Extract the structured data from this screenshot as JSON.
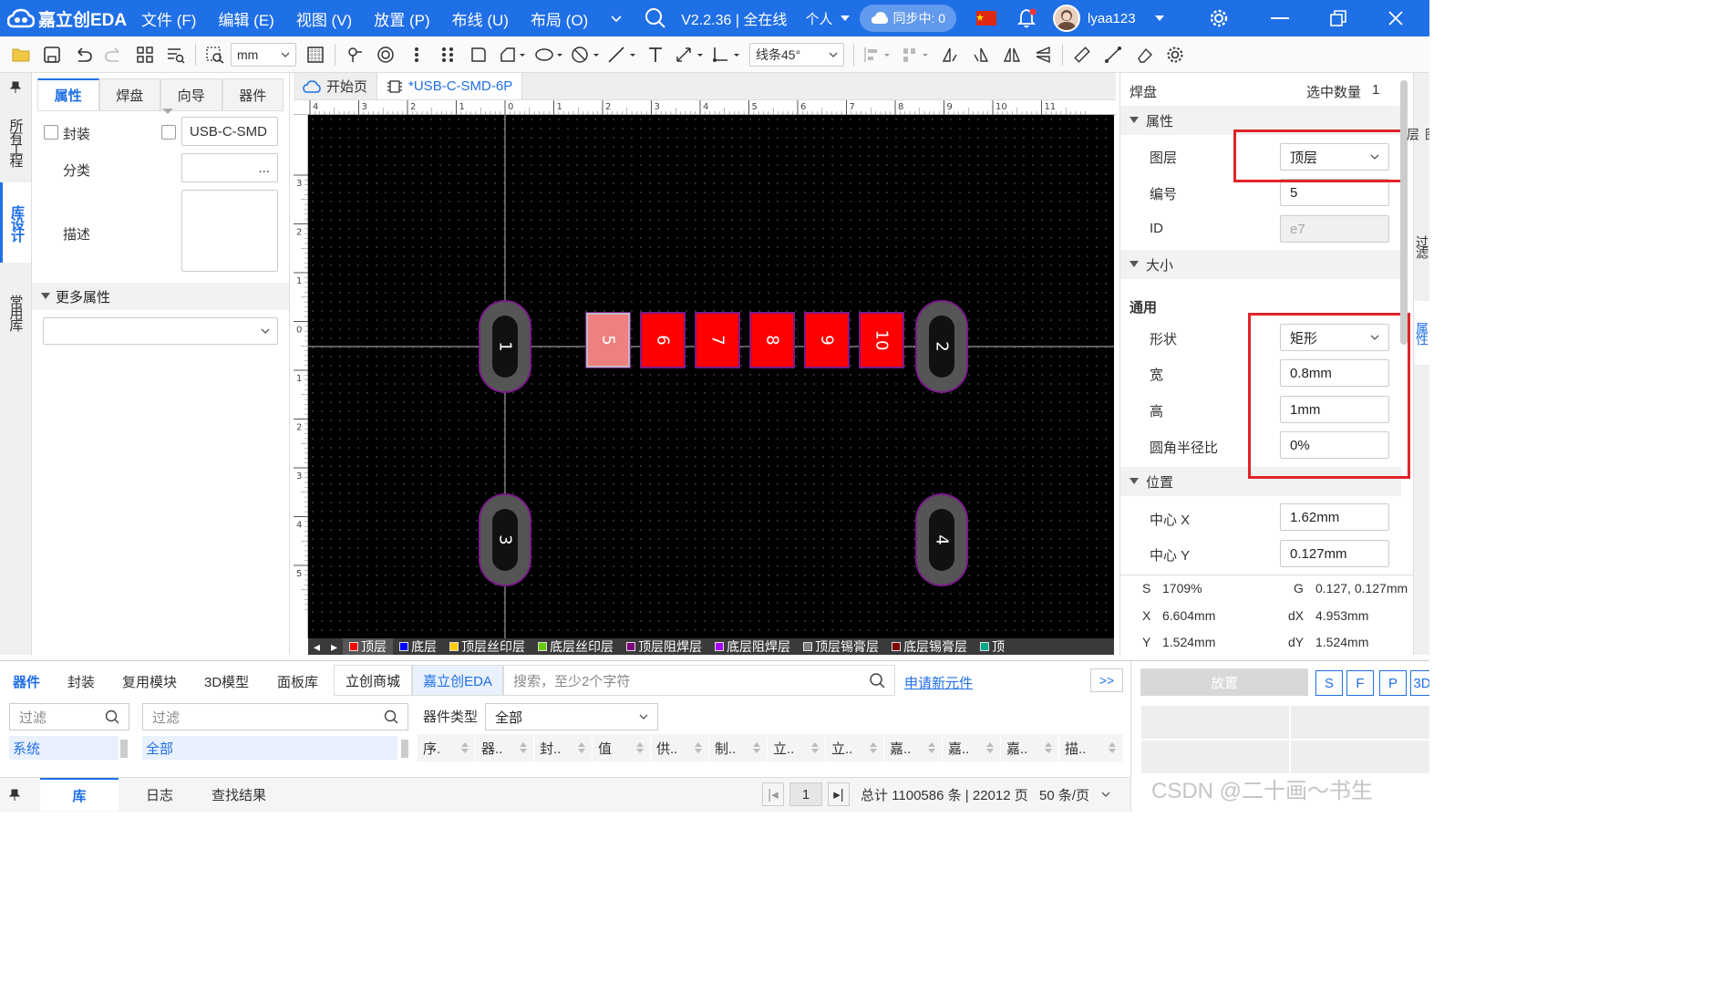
{
  "app": {
    "logo": "嘉立创EDA",
    "menus": [
      "文件 (F)",
      "编辑 (E)",
      "视图 (V)",
      "放置 (P)",
      "布线 (U)",
      "布局 (O)"
    ],
    "version": "V2.2.36 | 全在线",
    "mode": "个人",
    "sync": "同步中: 0",
    "user": "lyaa123"
  },
  "toolbar": {
    "unit": "mm",
    "line_mode": "线条45°"
  },
  "left_tabs": [
    "所有工程",
    "库设计",
    "常用库"
  ],
  "left_panel": {
    "tabs": [
      "属性",
      "焊盘",
      "向导",
      "器件"
    ],
    "footprint_label": "封装",
    "footprint_value": "USB-C-SMD",
    "category_label": "分类",
    "category_btn": "...",
    "desc_label": "描述",
    "more_props": "更多属性"
  },
  "doc_tabs": [
    "开始页",
    "*USB-C-SMD-6P"
  ],
  "ruler_x": [
    "4",
    "3",
    "2",
    "1",
    "0",
    "1",
    "2",
    "3",
    "4",
    "5",
    "6",
    "7",
    "8",
    "9",
    "10",
    "11"
  ],
  "ruler_y": [
    "3",
    "2",
    "1",
    "0",
    "1",
    "2",
    "3",
    "4",
    "5"
  ],
  "pads": [
    {
      "label": "1",
      "kind": "oval",
      "color": "#555555"
    },
    {
      "label": "2",
      "kind": "oval",
      "color": "#555555"
    },
    {
      "label": "3",
      "kind": "oval",
      "color": "#555555"
    },
    {
      "label": "4",
      "kind": "oval",
      "color": "#555555"
    },
    {
      "label": "5",
      "kind": "rect",
      "color": "#f08080",
      "selected": true
    },
    {
      "label": "6",
      "kind": "rect",
      "color": "#ff0000"
    },
    {
      "label": "7",
      "kind": "rect",
      "color": "#ff0000"
    },
    {
      "label": "8",
      "kind": "rect",
      "color": "#ff0000"
    },
    {
      "label": "9",
      "kind": "rect",
      "color": "#ff0000"
    },
    {
      "label": "10",
      "kind": "rect",
      "color": "#ff0000"
    }
  ],
  "layers": [
    {
      "name": "顶层",
      "color": "#ff0000"
    },
    {
      "name": "底层",
      "color": "#0000ff"
    },
    {
      "name": "顶层丝印层",
      "color": "#ffcc00"
    },
    {
      "name": "底层丝印层",
      "color": "#66cc00"
    },
    {
      "name": "顶层阻焊层",
      "color": "#800080"
    },
    {
      "name": "底层阻焊层",
      "color": "#aa00ff"
    },
    {
      "name": "顶层锡膏层",
      "color": "#808080"
    },
    {
      "name": "底层锡膏层",
      "color": "#800000"
    },
    {
      "name": "顶",
      "color": "#00aa88"
    }
  ],
  "right_panel": {
    "title": "焊盘",
    "selected_count_label": "选中数量",
    "selected_count": "1",
    "sec_attr": "属性",
    "layer_label": "图层",
    "layer_value": "顶层",
    "number_label": "编号",
    "number_value": "5",
    "id_label": "ID",
    "id_value": "e7",
    "sec_size": "大小",
    "general": "通用",
    "shape_label": "形状",
    "shape_value": "矩形",
    "width_label": "宽",
    "width_value": "0.8mm",
    "height_label": "高",
    "height_value": "1mm",
    "radius_label": "圆角半径比",
    "radius_value": "0%",
    "sec_pos": "位置",
    "cx_label": "中心 X",
    "cx_value": "1.62mm",
    "cy_label": "中心 Y",
    "cy_value": "0.127mm"
  },
  "status": {
    "s_label": "S",
    "s_value": "1709%",
    "g_label": "G",
    "g_value": "0.127, 0.127mm",
    "x_label": "X",
    "x_value": "6.604mm",
    "dx_label": "dX",
    "dx_value": "4.953mm",
    "y_label": "Y",
    "y_value": "1.524mm",
    "dy_label": "dY",
    "dy_value": "1.524mm"
  },
  "right_tabs": [
    "图层",
    "过滤",
    "属性"
  ],
  "bottom": {
    "tabs": [
      "器件",
      "封装",
      "复用模块",
      "3D模型",
      "面板库"
    ],
    "source_tabs": [
      "立创商城",
      "嘉立创EDA"
    ],
    "search_placeholder": "搜索，至少2个字符",
    "apply_link": "申请新元件",
    "more": ">>",
    "filter_placeholder": "过滤",
    "tree_left": "系统",
    "tree_right": "全部",
    "type_label": "器件类型",
    "type_value": "全部",
    "columns": [
      "序.",
      "器..",
      "封..",
      "值",
      "供..",
      "制..",
      "立..",
      "立..",
      "嘉..",
      "嘉..",
      "嘉..",
      "描.."
    ]
  },
  "footer": {
    "tabs": [
      "库",
      "日志",
      "查找结果"
    ],
    "page": "1",
    "total": "总计 1100586 条 | 22012 页",
    "per_page": "50 条/页"
  },
  "bottom_right": {
    "place_label": "放置",
    "buttons": [
      "S",
      "F",
      "P",
      "3D"
    ],
    "watermark": "CSDN @二十画～书生"
  }
}
